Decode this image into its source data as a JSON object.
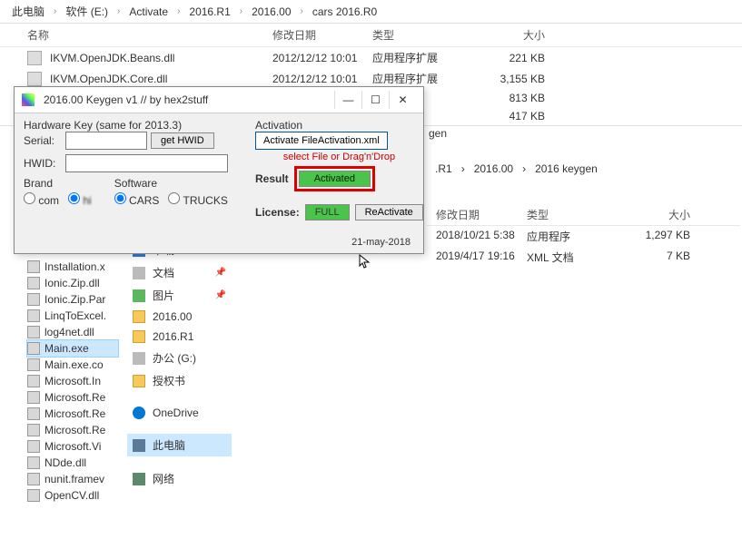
{
  "breadcrumb": {
    "items": [
      "此电脑",
      "软件 (E:)",
      "Activate",
      "2016.R1",
      "2016.00",
      "cars 2016.R0"
    ]
  },
  "sep": "›",
  "columns": {
    "name": "名称",
    "date": "修改日期",
    "type": "类型",
    "size": "大小"
  },
  "files_top": [
    {
      "name": "IKVM.OpenJDK.Beans.dll",
      "date": "2012/12/12 10:01",
      "type": "应用程序扩展",
      "size": "221 KB"
    },
    {
      "name": "IKVM.OpenJDK.Core.dll",
      "date": "2012/12/12 10:01",
      "type": "应用程序扩展",
      "size": "3,155 KB"
    },
    {
      "name": "",
      "date": "",
      "type": "",
      "size": "813 KB"
    },
    {
      "name": "",
      "date": "",
      "type": "",
      "size": "417 KB"
    }
  ],
  "hidden_gen": "gen",
  "files_left": [
    "Installation.x",
    "Ionic.Zip.dll",
    "Ionic.Zip.Par",
    "LinqToExcel.",
    "log4net.dll",
    "Main.exe",
    "Main.exe.co",
    "Microsoft.In",
    "Microsoft.Re",
    "Microsoft.Re",
    "Microsoft.Re",
    "Microsoft.Vi",
    "NDde.dll",
    "nunit.framev",
    "OpenCV.dll"
  ],
  "files_left_selected_idx": 5,
  "sidebar": [
    {
      "label": "下载",
      "icon": "si-blue",
      "pin": true
    },
    {
      "label": "文档",
      "icon": "si-gray",
      "pin": true
    },
    {
      "label": "图片",
      "icon": "si-green",
      "pin": true
    },
    {
      "label": "2016.00",
      "icon": "si-yellow",
      "pin": false
    },
    {
      "label": "2016.R1",
      "icon": "si-yellow",
      "pin": false
    },
    {
      "label": "办公 (G:)",
      "icon": "si-gray",
      "pin": false
    },
    {
      "label": "授权书",
      "icon": "si-yellow",
      "pin": false
    }
  ],
  "sidebar2": [
    {
      "label": "OneDrive",
      "icon": "si-onedrive"
    },
    {
      "label": "此电脑",
      "icon": "si-pc",
      "selected": true
    },
    {
      "label": "网络",
      "icon": "si-net"
    }
  ],
  "explorer2": {
    "bc": [
      ".R1",
      "2016.00",
      "2016 keygen"
    ],
    "rows": [
      {
        "date": "2018/10/21 5:38",
        "type": "应用程序",
        "size": "1,297 KB"
      },
      {
        "date": "2019/4/17 19:16",
        "type": "XML 文档",
        "size": "7 KB"
      }
    ]
  },
  "keygen": {
    "title": "2016.00 Keygen v1   //   by hex2stuff",
    "hw_label": "Hardware Key (same for 2013.3)",
    "serial_label": "Serial:",
    "hwid_label": "HWID:",
    "get_hwid": "get HWID",
    "brand_label": "Brand",
    "software_label": "Software",
    "brand1": "com",
    "brand2": "hi",
    "soft1": "CARS",
    "soft2": "TRUCKS",
    "activation": "Activation",
    "activate_btn": "Activate FileActivation.xml",
    "selectfile": "select File or Drag'n'Drop",
    "result_label": "Result",
    "activated": "Activated",
    "license_label": "License:",
    "full": "FULL",
    "reactivate": "ReActivate",
    "date": "21-may-2018",
    "min": "—",
    "restore": "☐",
    "close": "✕"
  }
}
